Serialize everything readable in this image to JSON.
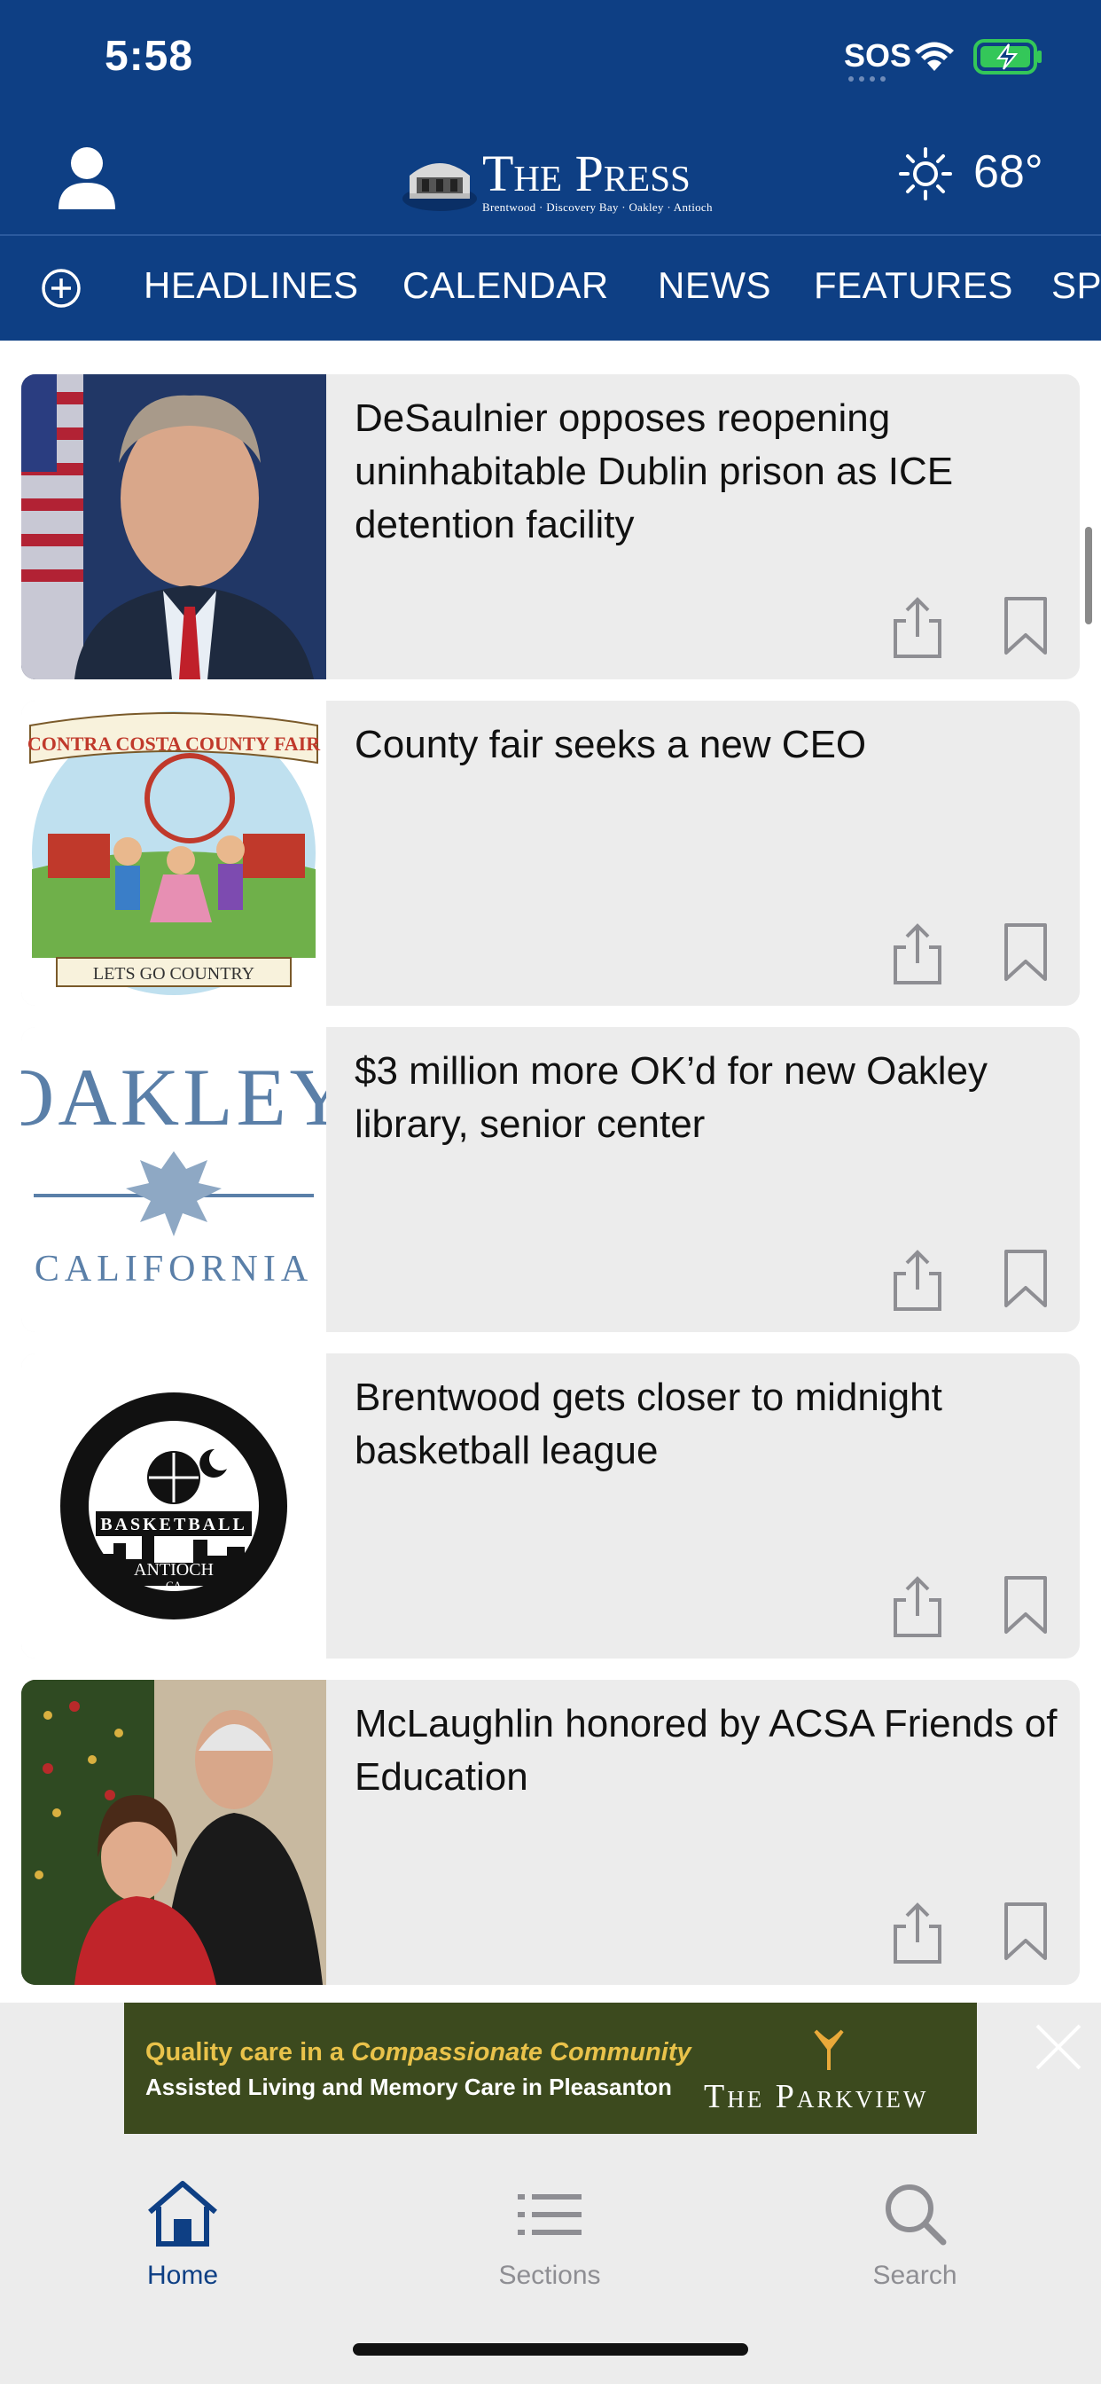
{
  "status_bar": {
    "time": "5:58",
    "sos": "SOS"
  },
  "header": {
    "logo_title": "The Press",
    "logo_subtitle": "Brentwood · Discovery Bay · Oakley · Antioch",
    "temperature": "68°",
    "weather_icon": "sun-icon"
  },
  "nav": {
    "items": [
      {
        "label": "HEADLINES"
      },
      {
        "label": "CALENDAR"
      },
      {
        "label": "NEWS"
      },
      {
        "label": "FEATURES"
      },
      {
        "label": "SPO"
      }
    ]
  },
  "articles": [
    {
      "headline": "DeSaulnier opposes reopening uninhabitable Dublin prison as ICE detention facility"
    },
    {
      "headline": "County fair seeks a new CEO",
      "thumb_title": "CONTRA COSTA COUNTY FAIR",
      "thumb_banner": "LETS GO COUNTRY"
    },
    {
      "headline": "$3 million more OK’d for new Oakley library, senior center",
      "thumb_title": "OAKLEY",
      "thumb_sub": "CALIFORNIA"
    },
    {
      "headline": "Brentwood gets closer to midnight basketball league",
      "thumb_title": "BASKETBALL",
      "thumb_city": "ANTIOCH",
      "thumb_state": "CA"
    },
    {
      "headline": "McLaughlin honored by ACSA Friends of Education"
    }
  ],
  "ad": {
    "line1_prefix": "Quality care in a ",
    "line1_emph": "Compassionate Community",
    "line2": "Assisted Living and Memory Care in Pleasanton",
    "brand": "The Parkview"
  },
  "tabbar": {
    "tabs": [
      {
        "label": "Home",
        "icon": "home-icon",
        "active": true
      },
      {
        "label": "Sections",
        "icon": "list-icon",
        "active": false
      },
      {
        "label": "Search",
        "icon": "search-icon",
        "active": false
      }
    ]
  },
  "colors": {
    "header_bg": "#0e3f84",
    "tab_active": "#0e3f84",
    "tab_inactive": "#8e8e93",
    "battery": "#34c759"
  }
}
